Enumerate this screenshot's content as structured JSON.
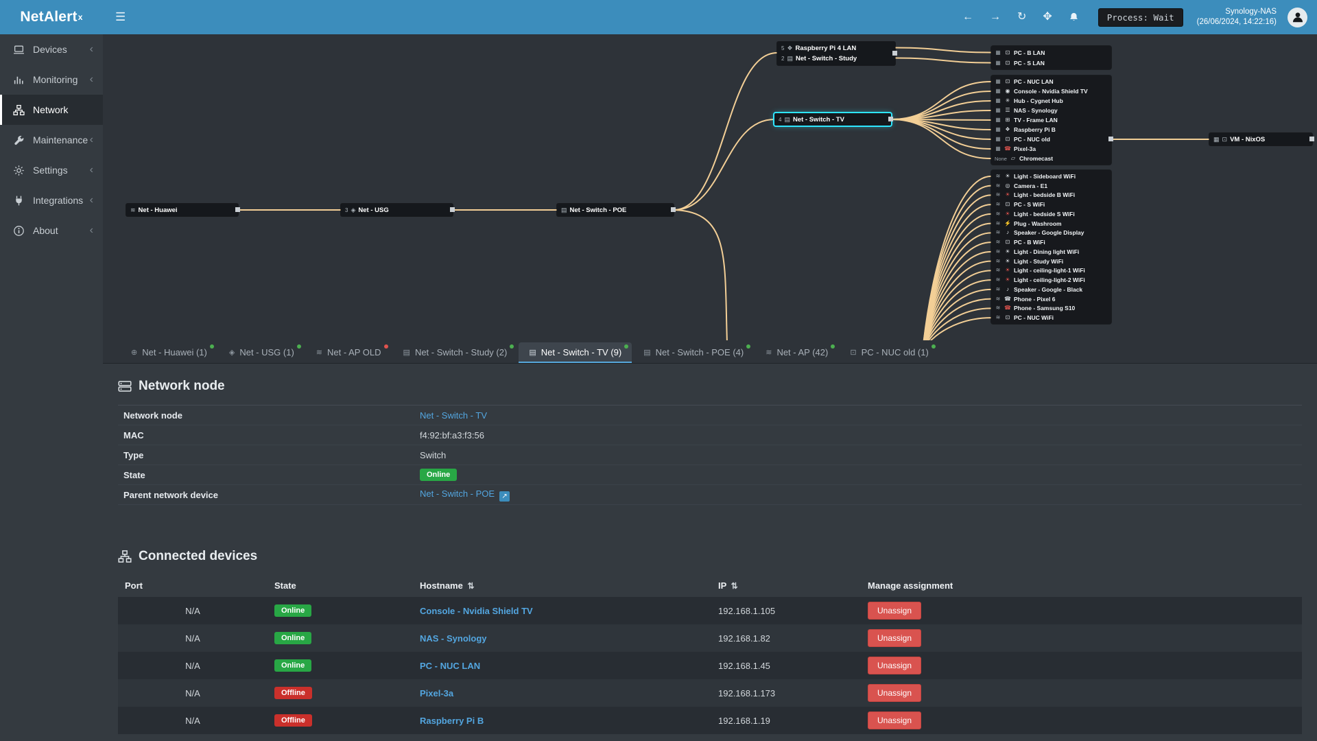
{
  "header": {
    "app_name": "NetAlert",
    "app_sup": "x",
    "nav_icons": [
      "back",
      "forward",
      "refresh",
      "move",
      "bell"
    ],
    "process_label": "Process: Wait",
    "server_name": "Synology-NAS",
    "server_time": "(26/06/2024, 14:22:16)"
  },
  "colors": {
    "accent": "#3c8dbc",
    "link": "#53a6e0",
    "online": "#28a745",
    "offline": "#ca302b",
    "curve": "#f3cf96",
    "highlight": "#2ee6ff",
    "dot_green": "#4caf50",
    "dot_red": "#e0534e"
  },
  "sidebar": {
    "items": [
      {
        "label": "Devices",
        "icon": "devices",
        "active": false
      },
      {
        "label": "Monitoring",
        "icon": "monitoring",
        "active": false
      },
      {
        "label": "Network",
        "icon": "network",
        "active": true
      },
      {
        "label": "Maintenance",
        "icon": "maintenance",
        "active": false
      },
      {
        "label": "Settings",
        "icon": "settings",
        "active": false
      },
      {
        "label": "Integrations",
        "icon": "integrations",
        "active": false
      },
      {
        "label": "About",
        "icon": "about",
        "active": false
      }
    ]
  },
  "topology": {
    "chain_nodes": [
      {
        "label": "Net - Huawei",
        "icon": "wifi",
        "count": "",
        "highlight": false
      },
      {
        "label": "Net - USG",
        "icon": "shield",
        "count": "3",
        "highlight": false
      },
      {
        "label": "Net - Switch - POE",
        "icon": "switch",
        "count": "",
        "highlight": false
      },
      {
        "label": "Net - Switch - TV",
        "icon": "switch",
        "count": "4",
        "highlight": true
      }
    ],
    "study_box": [
      {
        "label": "Raspberry Pi 4 LAN",
        "icon": "pi",
        "count": "5"
      },
      {
        "label": "Net - Switch - Study",
        "icon": "switch",
        "count": "2"
      }
    ],
    "lan_cluster": [
      {
        "label": "PC - B LAN",
        "icon": "pc",
        "offline": false
      },
      {
        "label": "PC - S LAN",
        "icon": "pc",
        "offline": false
      }
    ],
    "tv_cluster": [
      {
        "label": "PC - NUC LAN",
        "icon": "pc",
        "offline": false
      },
      {
        "label": "Console - Nvidia Shield TV",
        "icon": "console",
        "offline": false
      },
      {
        "label": "Hub - Cygnet Hub",
        "icon": "hub",
        "offline": false
      },
      {
        "label": "NAS - Synology",
        "icon": "nas",
        "offline": false
      },
      {
        "label": "TV - Frame LAN",
        "icon": "tv",
        "offline": false
      },
      {
        "label": "Raspberry Pi B",
        "icon": "pi",
        "offline": false
      },
      {
        "label": "PC - NUC old",
        "icon": "pc",
        "offline": false
      },
      {
        "label": "Pixel-3a",
        "icon": "phone",
        "offline": true
      },
      {
        "label": "Chromecast",
        "icon": "cast",
        "offline": false,
        "prefix": "None"
      }
    ],
    "wifi_cluster": [
      {
        "label": "Light - Sideboard WiFi",
        "icon": "bulb",
        "offline": false
      },
      {
        "label": "Camera - E1",
        "icon": "camera",
        "offline": false
      },
      {
        "label": "Light - bedside B WiFi",
        "icon": "bulb",
        "offline": true
      },
      {
        "label": "PC - S WiFi",
        "icon": "pc",
        "offline": false
      },
      {
        "label": "Light - bedside S WiFi",
        "icon": "bulb",
        "offline": true
      },
      {
        "label": "Plug - Washroom",
        "icon": "plug",
        "offline": false
      },
      {
        "label": "Speaker - Google Display",
        "icon": "speaker",
        "offline": false
      },
      {
        "label": "PC - B WiFi",
        "icon": "pc",
        "offline": false
      },
      {
        "label": "Light - Dining light WiFi",
        "icon": "bulb",
        "offline": false
      },
      {
        "label": "Light - Study WiFi",
        "icon": "bulb",
        "offline": false
      },
      {
        "label": "Light - ceiling-light-1 WiFi",
        "icon": "bulb",
        "offline": true
      },
      {
        "label": "Light - ceiling-light-2 WiFi",
        "icon": "bulb",
        "offline": true
      },
      {
        "label": "Speaker - Google - Black",
        "icon": "speaker",
        "offline": false
      },
      {
        "label": "Phone - Pixel 6",
        "icon": "phone",
        "offline": false
      },
      {
        "label": "Phone - Samsung S10",
        "icon": "phone",
        "offline": true
      },
      {
        "label": "PC - NUC WiFi",
        "icon": "pc",
        "offline": false
      }
    ],
    "vm_node": {
      "label": "VM - NixOS",
      "icon": "pc"
    }
  },
  "tabs": [
    {
      "label": "Net - Huawei (1)",
      "icon": "globe",
      "dot": "green",
      "active": false
    },
    {
      "label": "Net - USG (1)",
      "icon": "shield",
      "dot": "green",
      "active": false
    },
    {
      "label": "Net - AP OLD",
      "icon": "wifi",
      "dot": "red",
      "active": false
    },
    {
      "label": "Net - Switch - Study (2)",
      "icon": "switch",
      "dot": "green",
      "active": false
    },
    {
      "label": "Net - Switch - TV (9)",
      "icon": "switch",
      "dot": "green",
      "active": true
    },
    {
      "label": "Net - Switch - POE (4)",
      "icon": "switch",
      "dot": "green",
      "active": false
    },
    {
      "label": "Net - AP (42)",
      "icon": "wifi",
      "dot": "green",
      "active": false
    },
    {
      "label": "PC - NUC old (1)",
      "icon": "pc",
      "dot": "green",
      "active": false
    }
  ],
  "network_node": {
    "title": "Network node",
    "rows": [
      {
        "label": "Network node",
        "value": "Net - Switch - TV",
        "type": "link"
      },
      {
        "label": "MAC",
        "value": "f4:92:bf:a3:f3:56",
        "type": "text"
      },
      {
        "label": "Type",
        "value": "Switch",
        "type": "text"
      },
      {
        "label": "State",
        "value": "Online",
        "type": "badge"
      },
      {
        "label": "Parent network device",
        "value": "Net - Switch - POE",
        "type": "link-ext"
      }
    ]
  },
  "connected_devices": {
    "title": "Connected devices",
    "columns": [
      {
        "label": "Port",
        "sortable": false
      },
      {
        "label": "State",
        "sortable": false
      },
      {
        "label": "Hostname",
        "sortable": true
      },
      {
        "label": "IP",
        "sortable": true
      },
      {
        "label": "Manage assignment",
        "sortable": false
      }
    ],
    "rows": [
      {
        "port": "N/A",
        "state": "Online",
        "hostname": "Console - Nvidia Shield TV",
        "ip": "192.168.1.105",
        "action": "Unassign"
      },
      {
        "port": "N/A",
        "state": "Online",
        "hostname": "NAS - Synology",
        "ip": "192.168.1.82",
        "action": "Unassign"
      },
      {
        "port": "N/A",
        "state": "Online",
        "hostname": "PC - NUC LAN",
        "ip": "192.168.1.45",
        "action": "Unassign"
      },
      {
        "port": "N/A",
        "state": "Offline",
        "hostname": "Pixel-3a",
        "ip": "192.168.1.173",
        "action": "Unassign"
      },
      {
        "port": "N/A",
        "state": "Offline",
        "hostname": "Raspberry Pi B",
        "ip": "192.168.1.19",
        "action": "Unassign"
      }
    ]
  }
}
